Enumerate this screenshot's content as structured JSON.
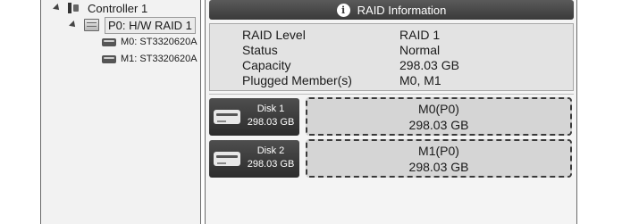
{
  "tree": {
    "controller": {
      "label": "Controller 1"
    },
    "raid": {
      "label": "P0: H/W RAID 1"
    },
    "disks": [
      {
        "label": "M0: ST3320620A"
      },
      {
        "label": "M1: ST3320620A"
      }
    ]
  },
  "raid_info": {
    "header": "RAID Information",
    "rows": [
      {
        "label": "RAID Level",
        "value": "RAID 1"
      },
      {
        "label": "Status",
        "value": "Normal"
      },
      {
        "label": "Capacity",
        "value": "298.03 GB"
      },
      {
        "label": "Plugged Member(s)",
        "value": "M0, M1"
      }
    ]
  },
  "disks": [
    {
      "name": "Disk 1",
      "capacity": "298.03 GB",
      "member": "M0(P0)",
      "member_capacity": "298.03 GB"
    },
    {
      "name": "Disk 2",
      "capacity": "298.03 GB",
      "member": "M1(P0)",
      "member_capacity": "298.03 GB"
    }
  ],
  "icons": {
    "controller": "controller-icon",
    "raid": "raid-volume-icon",
    "disk": "hard-drive-icon",
    "info": "info-icon",
    "expander": "expand-arrow-icon"
  },
  "colors": {
    "header_bg": "#3a3a3a",
    "panel_bg": "#f4f4f4",
    "info_box_bg": "#e3e3e3",
    "disk_tile_bg": "#2c2c2c",
    "member_box_bg": "#d5d5d5"
  }
}
